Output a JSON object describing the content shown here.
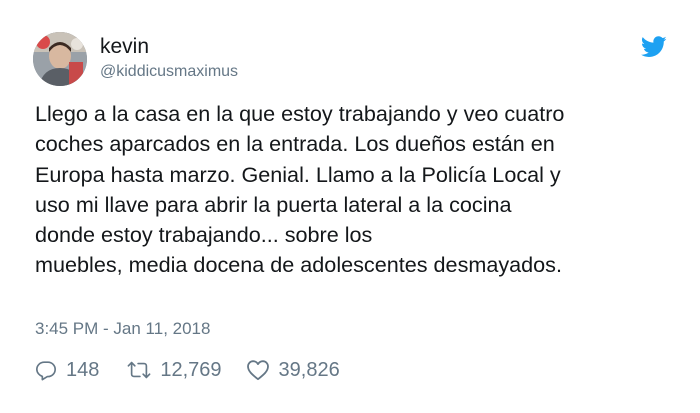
{
  "tweet": {
    "author": {
      "display_name": "kevin",
      "handle": "@kiddicusmaximus",
      "avatar_icon": "avatar-photo"
    },
    "brand_icon": "twitter-bird-icon",
    "brand_color": "#1da1f2",
    "text_lines": [
      "Llego a la casa en la que estoy trabajando y veo cuatro",
      "coches aparcados en la entrada. Los dueños están en",
      "Europa hasta marzo. Genial. Llamo a la Policía Local y",
      "uso mi llave para abrir la puerta lateral a la cocina",
      "donde estoy trabajando... sobre los",
      "muebles, media docena de adolescentes desmayados."
    ],
    "timestamp": "3:45 PM - Jan 11, 2018",
    "stats": {
      "replies": "148",
      "retweets": "12,769",
      "likes": "39,826"
    },
    "muted_color": "#657786"
  }
}
